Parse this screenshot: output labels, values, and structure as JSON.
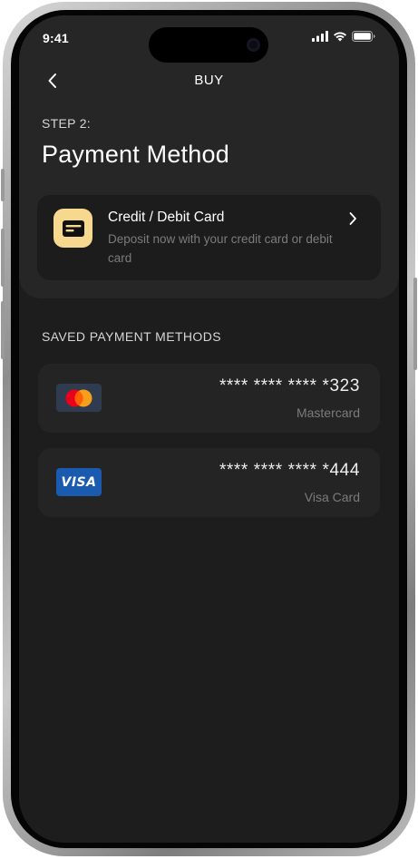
{
  "status_bar": {
    "time": "9:41",
    "icons": [
      "cellular-signal-icon",
      "wifi-icon",
      "battery-icon"
    ]
  },
  "header": {
    "title": "BUY",
    "back_icon": "chevron-left-icon"
  },
  "step": {
    "label": "STEP 2:",
    "title": "Payment Method"
  },
  "payment_option": {
    "title": "Credit / Debit Card",
    "description": "Deposit now with your credit card or debit card",
    "icon": "credit-card-icon",
    "chevron_icon": "chevron-right-icon"
  },
  "saved": {
    "section_label": "SAVED PAYMENT METHODS",
    "cards": [
      {
        "number": "**** **** **** *323",
        "type": "Mastercard",
        "logo": "mastercard-logo"
      },
      {
        "number": "**** **** **** *444",
        "type": "Visa Card",
        "logo": "visa-logo"
      }
    ]
  },
  "colors": {
    "background": "#1d1d1d",
    "panel": "#262626",
    "card": "#242424",
    "accent": "#f6d98f",
    "muted_text": "#7b7b7b",
    "visa_blue": "#1a5bb0",
    "mastercard_red": "#eb001b",
    "mastercard_orange": "#f79e1b"
  }
}
